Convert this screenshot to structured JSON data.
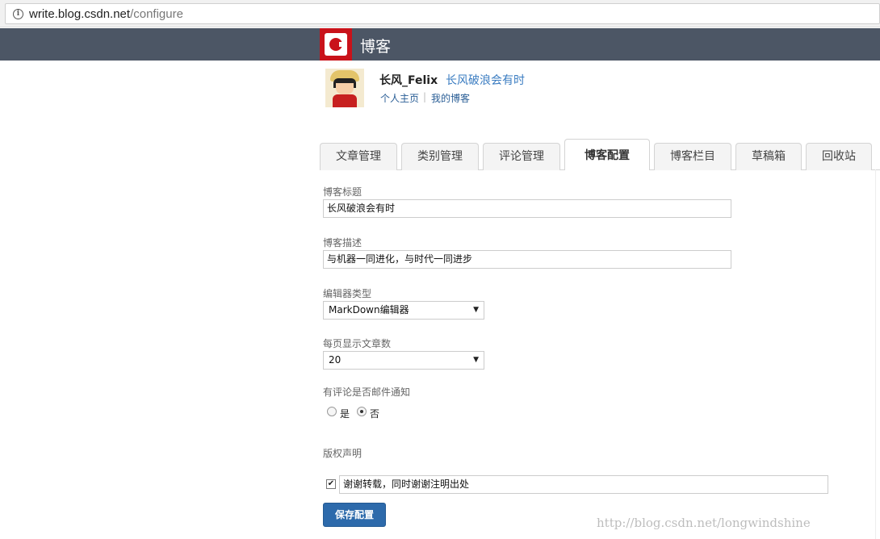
{
  "browser": {
    "url_host": "write.blog.csdn.net",
    "url_path": "/configure",
    "info_icon": "info-icon"
  },
  "header": {
    "logo_icon": "csdn-logo",
    "title": "博客",
    "bg_color": "#4c5665",
    "logo_color": "#c9121a"
  },
  "profile": {
    "username": "长风_Felix",
    "blog_name": "长风破浪会有时",
    "links": [
      "个人主页",
      "我的博客"
    ],
    "separator": "|"
  },
  "tabs": [
    {
      "label": "文章管理",
      "active": false
    },
    {
      "label": "类别管理",
      "active": false
    },
    {
      "label": "评论管理",
      "active": false
    },
    {
      "label": "博客配置",
      "active": true
    },
    {
      "label": "博客栏目",
      "active": false
    },
    {
      "label": "草稿箱",
      "active": false
    },
    {
      "label": "回收站",
      "active": false
    }
  ],
  "form": {
    "blog_title": {
      "label": "博客标题",
      "value": "长风破浪会有时"
    },
    "blog_desc": {
      "label": "博客描述",
      "value": "与机器一同进化，与时代一同进步"
    },
    "editor_type": {
      "label": "编辑器类型",
      "selected": "MarkDown编辑器"
    },
    "per_page": {
      "label": "每页显示文章数",
      "selected": "20"
    },
    "email_notify": {
      "label": "有评论是否邮件通知",
      "options": [
        {
          "label": "是",
          "checked": false
        },
        {
          "label": "否",
          "checked": true
        }
      ]
    },
    "copyright": {
      "label": "版权声明",
      "checked": true,
      "value": "谢谢转载，同时谢谢注明出处"
    },
    "save_label": "保存配置",
    "accent": "#2d6aab"
  },
  "watermark": "http://blog.csdn.net/longwindshine"
}
